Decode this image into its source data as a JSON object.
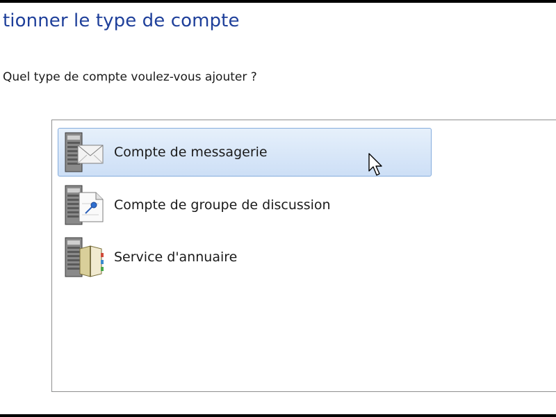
{
  "header": {
    "title": "tionner le type de compte"
  },
  "prompt": {
    "question": "Quel type de compte voulez-vous ajouter ?"
  },
  "account_types": {
    "selected_index": 0,
    "items": [
      {
        "label": "Compte de messagerie",
        "icon": "email-server-icon"
      },
      {
        "label": "Compte de groupe de discussion",
        "icon": "newsgroup-server-icon"
      },
      {
        "label": "Service d'annuaire",
        "icon": "directory-service-icon"
      }
    ]
  },
  "colors": {
    "title": "#1e3f9a",
    "selection_fill": "#cddff6",
    "selection_border": "#84acdd"
  }
}
